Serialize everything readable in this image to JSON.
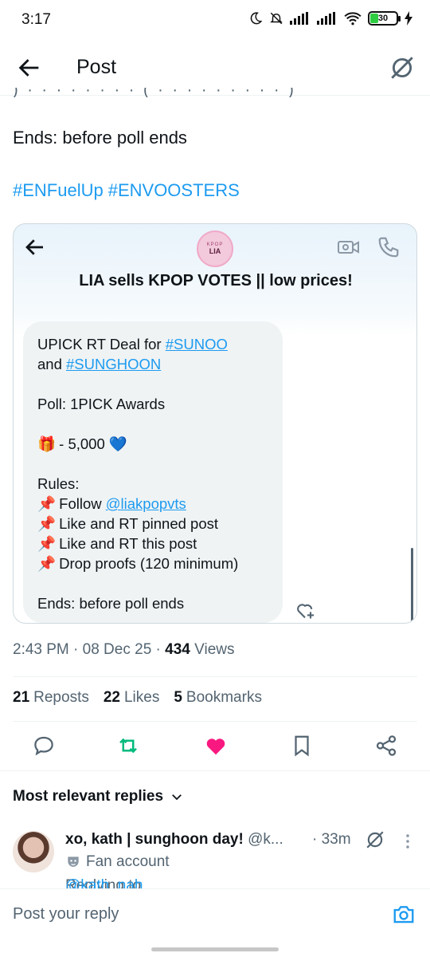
{
  "status_bar": {
    "time": "3:17",
    "battery": "30",
    "battery_level": 0.3
  },
  "app_bar": {
    "title": "Post"
  },
  "post": {
    "ends_line": "Ends: before poll ends",
    "hashtags": [
      "#ENFuelUp",
      "#ENVOOSTERS"
    ],
    "timestamp": "2:43 PM · 08 Dec 25 · ",
    "views_count": "434",
    "views_label": " Views",
    "stats": {
      "reposts_count": "21",
      "reposts_label": "Reposts",
      "likes_count": "22",
      "likes_label": "Likes",
      "bookmarks_count": "5",
      "bookmarks_label": "Bookmarks"
    }
  },
  "card": {
    "avatar_top": "KPOP",
    "avatar_name": "LIA",
    "title": "LIA sells KPOP VOTES || low prices!",
    "message": {
      "line1_text": "UPICK RT Deal for ",
      "line1_link": "#SUNOO",
      "line2_text": "and ",
      "line2_link": "#SUNGHOON",
      "poll": "Poll: 1PICK Awards",
      "gift_emoji": "🎁",
      "price": " - 5,000 ",
      "heart_emoji": "💙",
      "rules_heading": "Rules:",
      "pin_emoji": "📌",
      "rule1_text": " Follow ",
      "rule1_link": "@liakpopvts",
      "rule2": " Like and RT pinned post",
      "rule3": " Like and RT this post",
      "rule4": " Drop proofs (120 minimum)",
      "ends": "Ends: before poll ends"
    }
  },
  "replies": {
    "heading": "Most relevant replies",
    "items": [
      {
        "name": "xo, kath | sunghoon day!",
        "handle": " @k...",
        "time": "· 33m",
        "badge": "Fan account",
        "replying_prefix": "Replying to ",
        "replying_to": "@kath_nah"
      }
    ]
  },
  "compose": {
    "placeholder": "Post your reply"
  },
  "colors": {
    "accent": "#1d9bf0",
    "repost_green": "#00ba7c",
    "like_pink": "#f91880",
    "text": "#0f1419",
    "secondary": "#536471"
  },
  "icons": [
    "back-arrow-icon",
    "grok-icon",
    "video-call-icon",
    "phone-icon",
    "add-reaction-icon",
    "reply-icon",
    "repost-icon",
    "like-icon",
    "bookmark-icon",
    "share-icon",
    "chevron-down-icon",
    "more-vertical-icon",
    "camera-icon",
    "mask-icon"
  ]
}
